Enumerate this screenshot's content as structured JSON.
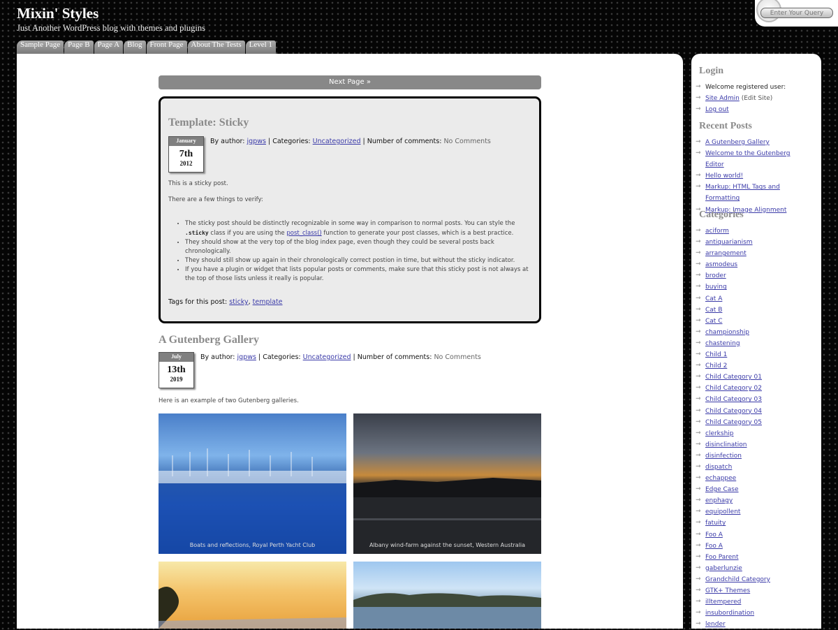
{
  "site": {
    "title": "Mixin' Styles",
    "description": "Just Another WordPress blog with themes and plugins"
  },
  "search": {
    "placeholder": "Enter Your Query"
  },
  "nav": [
    "Sample Page",
    "Page B",
    "Page A",
    "Blog",
    "Front Page",
    "About The Tests",
    "Level 1"
  ],
  "pagination": {
    "next": "Next Page »"
  },
  "sticky_post": {
    "title": "Template: Sticky",
    "date": {
      "month": "January",
      "day": "7th",
      "year": "2012"
    },
    "by_label": "By author:",
    "author": "jgpws",
    "cat_label": "Categories:",
    "category": "Uncategorized",
    "comments_label": "Number of comments:",
    "comments": "No Comments",
    "p1": "This is a sticky post.",
    "p2": "There are a few things to verify:",
    "b1_pre": "The sticky post should be distinctly recognizable in some way in comparison to normal posts. You can style the ",
    "b1_code": ".sticky",
    "b1_mid": " class if you are using the ",
    "b1_link": "post_class()",
    "b1_post": " function to generate your post classes, which is a best practice.",
    "b2": "They should show at the very top of the blog index page, even though they could be several posts back chronologically.",
    "b3": "They should still show up again in their chronologically correct postion in time, but without the sticky indicator.",
    "b4": "If you have a plugin or widget that lists popular posts or comments, make sure that this sticky post is not always at the top of those lists unless it really is popular.",
    "tags_label": "Tags for this post:",
    "tag1": "sticky",
    "tag2": "template"
  },
  "gallery_post": {
    "title": "A Gutenberg Gallery",
    "date": {
      "month": "July",
      "day": "13th",
      "year": "2019"
    },
    "by_label": "By author:",
    "author": "jgpws",
    "cat_label": "Categories:",
    "category": "Uncategorized",
    "comments_label": "Number of comments:",
    "comments": "No Comments",
    "intro": "Here is an example of two Gutenberg galleries.",
    "captions": [
      "Boats and reflections, Royal Perth Yacht Club",
      "Albany wind-farm against the sunset, Western Australia"
    ]
  },
  "sidebar": {
    "login_title": "Login",
    "welcome": "Welcome registered user:",
    "site_admin": "Site Admin",
    "edit_site": " (Edit Site)",
    "logout": "Log out",
    "recent_title": "Recent Posts",
    "recent": [
      "A Gutenberg Gallery",
      "Welcome to the Gutenberg Editor",
      "Hello world!",
      "Markup: HTML Tags and Formatting",
      "Markup: Image Alignment"
    ],
    "categories_title": "Categories",
    "categories": [
      "aciform",
      "antiquarianism",
      "arrangement",
      "asmodeus",
      "broder",
      "buying",
      "Cat A",
      "Cat B",
      "Cat C",
      "championship",
      "chastening",
      "Child 1",
      "Child 2",
      "Child Category 01",
      "Child Category 02",
      "Child Category 03",
      "Child Category 04",
      "Child Category 05",
      "clerkship",
      "disinclination",
      "disinfection",
      "dispatch",
      "echappee",
      "Edge Case",
      "enphagy",
      "equipollent",
      "fatuity",
      "Foo A",
      "Foo A",
      "Foo Parent",
      "gaberlunzie",
      "Grandchild Category",
      "GTK+ Themes",
      "illtempered",
      "insubordination",
      "lender"
    ]
  }
}
